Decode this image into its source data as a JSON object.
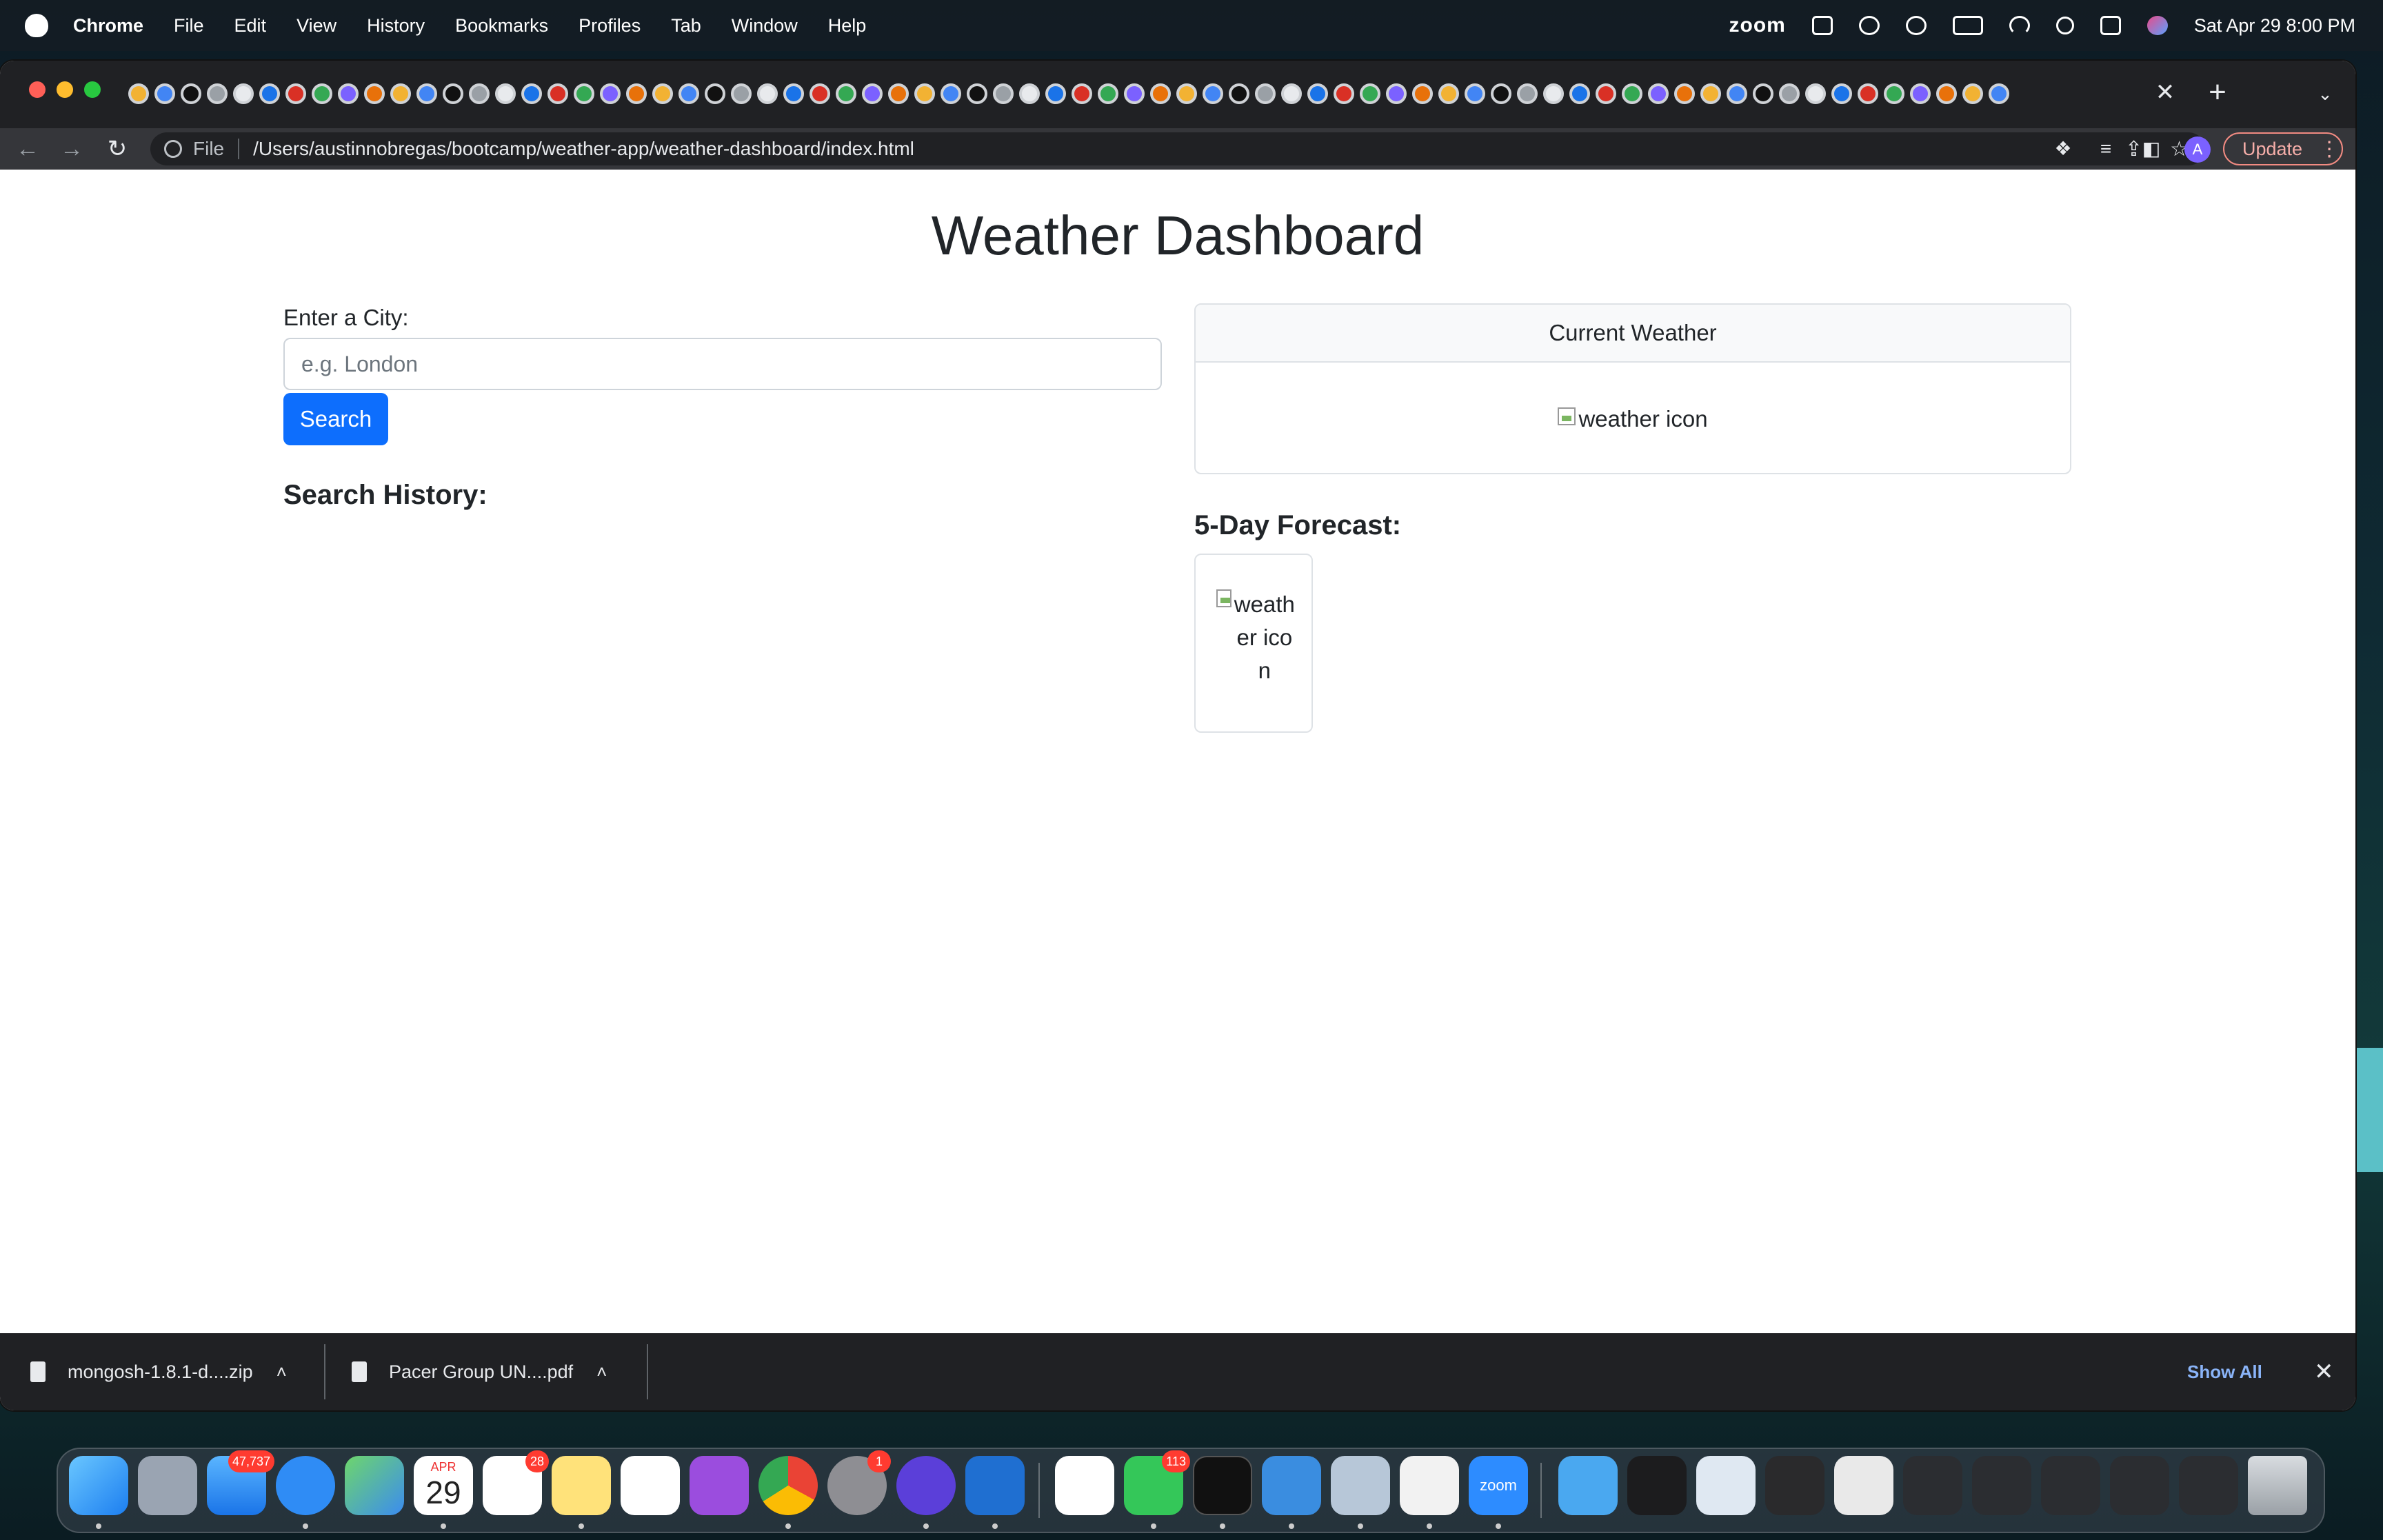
{
  "menubar": {
    "app": "Chrome",
    "items": [
      "File",
      "Edit",
      "View",
      "History",
      "Bookmarks",
      "Profiles",
      "Tab",
      "Window",
      "Help"
    ],
    "status_app": "zoom",
    "datetime": "Sat Apr 29  8:00 PM"
  },
  "browser": {
    "url_scheme": "File",
    "url": "/Users/austinnobregas/bootcamp/weather-app/weather-dashboard/index.html",
    "profile_initial": "A",
    "update_label": "Update",
    "tab_close": "✕",
    "new_tab": "+",
    "tab_list": "⌄",
    "favicon_count": 72
  },
  "page": {
    "title": "Weather Dashboard",
    "city_label": "Enter a City:",
    "city_placeholder": "e.g. London",
    "search_label": "Search",
    "history_heading": "Search History:",
    "current_header": "Current Weather",
    "current_icon_alt": "weather icon",
    "forecast_heading": "5-Day Forecast:",
    "forecast_icon_alt": "weather icon"
  },
  "downloads": {
    "items": [
      {
        "name": "mongosh-1.8.1-d....zip"
      },
      {
        "name": "Pacer Group UN....pdf"
      }
    ],
    "show_all": "Show All",
    "close": "✕"
  },
  "dock": {
    "mail_badge": "47,737",
    "calendar_month": "APR",
    "calendar_day": "29",
    "reminders_badge": "28",
    "settings_badge": "1",
    "messages_badge": "113",
    "zoom_label": "zoom"
  },
  "colors": {
    "primary_button": "#0d6efd",
    "chrome_dark": "#202124",
    "toolbar": "#35363a",
    "update_accent": "#f28b82"
  }
}
